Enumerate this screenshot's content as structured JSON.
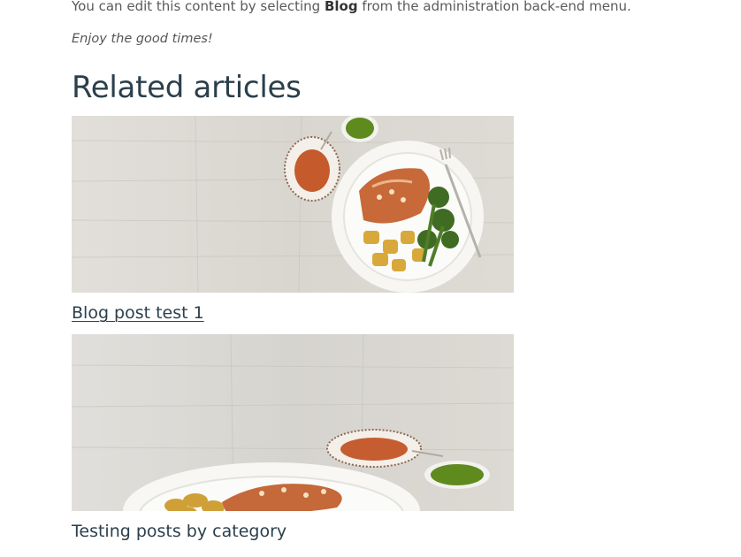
{
  "intro": {
    "before_bold": "You can edit this content by selecting ",
    "bold": "Blog",
    "after_bold": " from the administration back-end menu."
  },
  "enjoy_text": "Enjoy the good times!",
  "related": {
    "heading": "Related articles",
    "articles": [
      {
        "title": "Blog post test 1",
        "image_icon": "salmon-potatoes-broccoli-plate-photo"
      },
      {
        "title": "Testing posts by category",
        "image_icon": "chicken-potatoes-sauce-plate-photo"
      }
    ]
  },
  "colors": {
    "heading": "#2b3f4c",
    "link": "#2b3f4c",
    "body_text": "#5a5a5a",
    "wood_background": "#dcd9d3"
  }
}
